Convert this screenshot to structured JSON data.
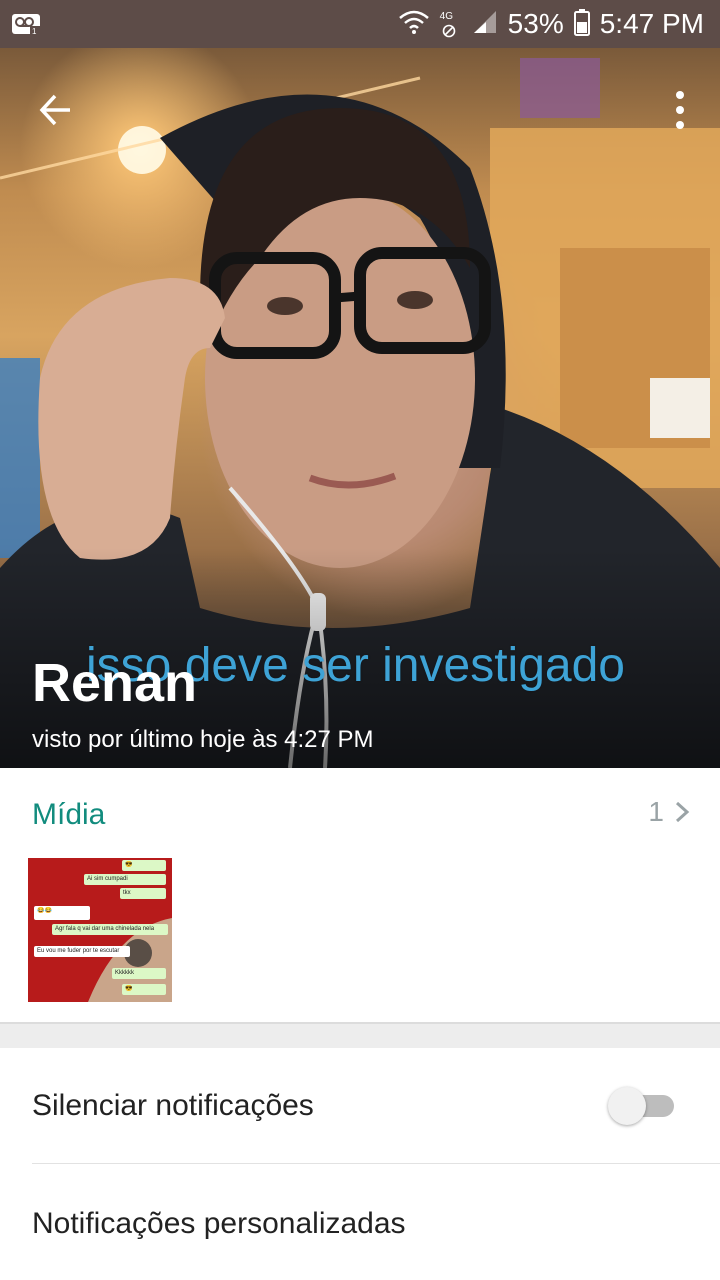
{
  "status_bar": {
    "network_label": "4G",
    "battery": "53%",
    "time": "5:47 PM",
    "icons": [
      "voicemail-icon",
      "wifi-icon",
      "no-data-icon",
      "signal-icon",
      "battery-icon"
    ]
  },
  "profile": {
    "name": "Renan",
    "last_seen": "visto por último hoje às 4:27 PM",
    "photo_caption": "isso deve ser investigado"
  },
  "media": {
    "title": "Mídia",
    "count": "1",
    "thumbnail_messages": [
      {
        "text": "Ai sim cumpadi",
        "side": "out"
      },
      {
        "text": "tkx",
        "side": "out"
      },
      {
        "text": "😂😂",
        "side": "in"
      },
      {
        "text": "Agr fala q vai dar uma chinelada nela",
        "side": "out"
      },
      {
        "text": "Eu vou me fuder por te escutar",
        "side": "in"
      },
      {
        "text": "Kkkkkk",
        "side": "out"
      }
    ]
  },
  "settings": {
    "mute_label": "Silenciar notificações",
    "mute_enabled": false,
    "custom_label": "Notificações personalizadas"
  },
  "colors": {
    "status_bar": "#5d4c48",
    "accent": "#128c7e",
    "caption": "#3ea3d6"
  }
}
